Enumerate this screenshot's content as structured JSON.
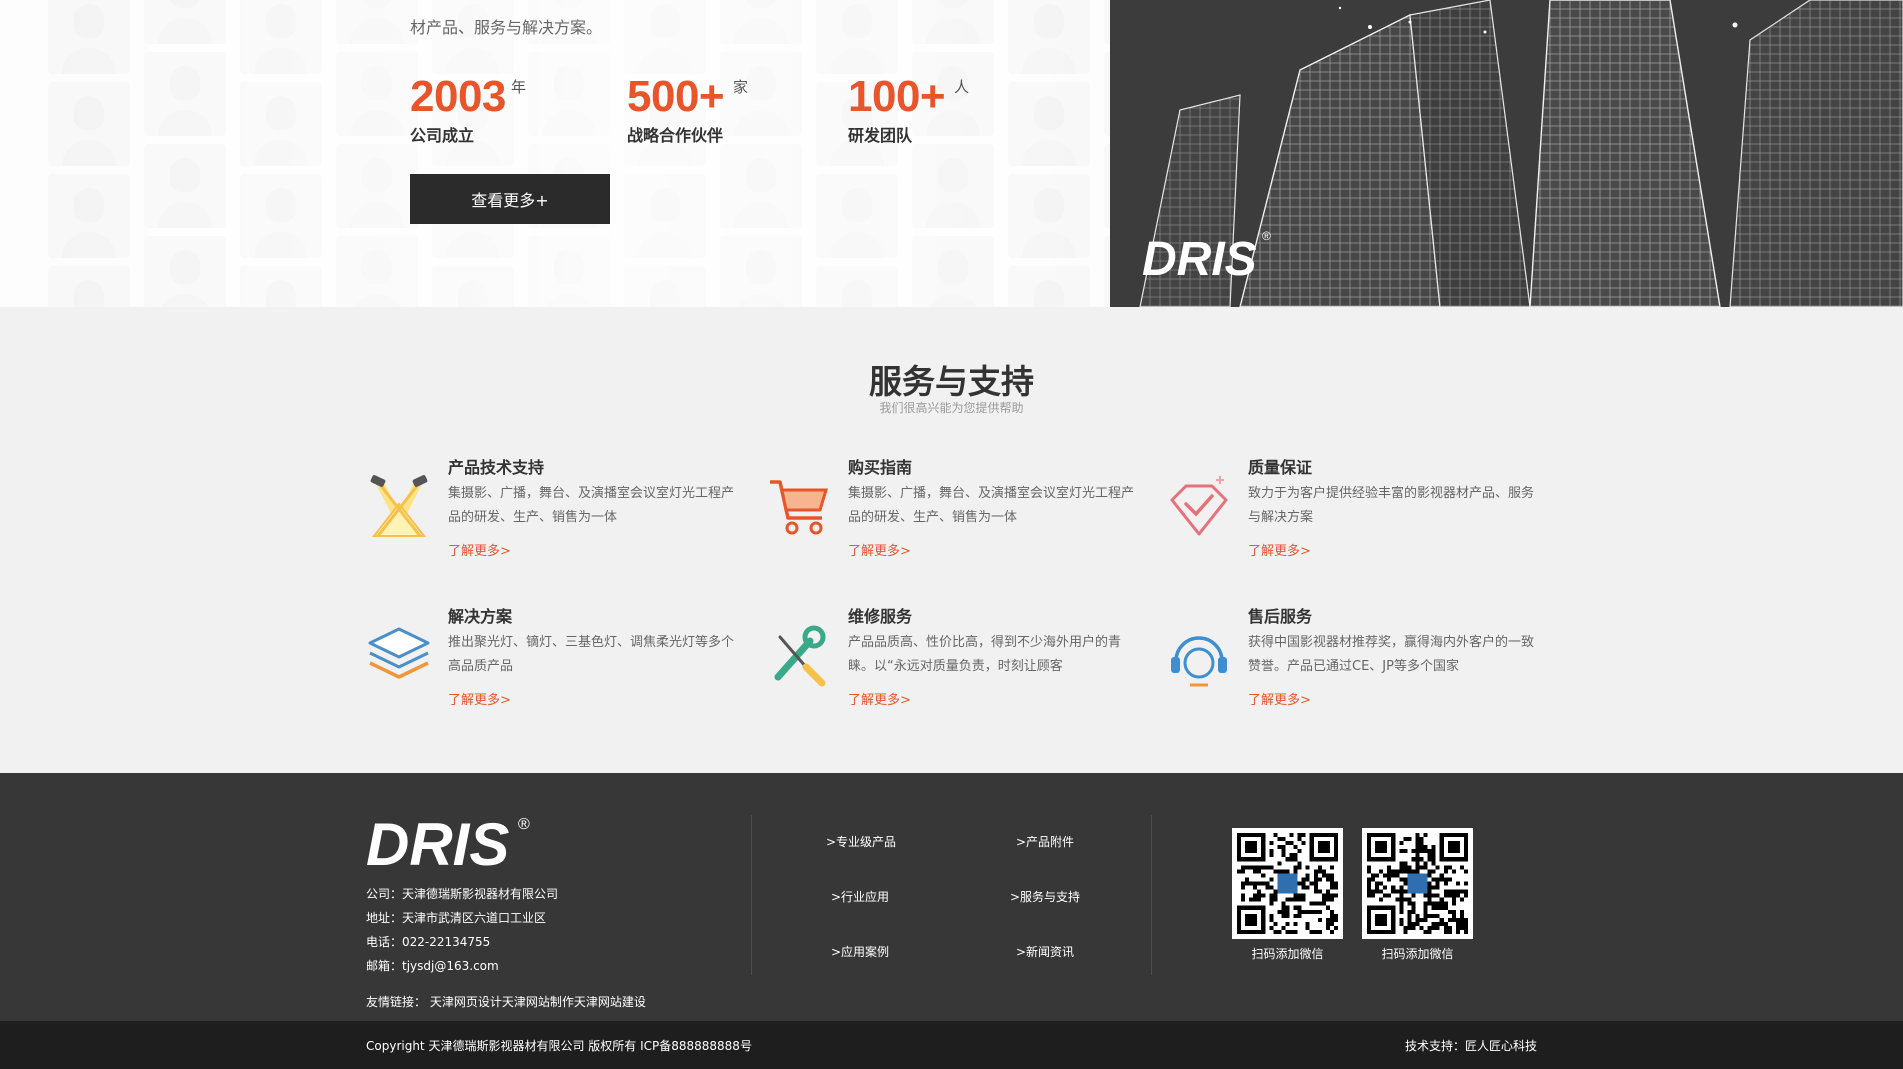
{
  "about": {
    "description_partial": "材产品、服务与解决方案。",
    "stats": [
      {
        "value": "2003",
        "unit": "年",
        "label": "公司成立"
      },
      {
        "value": "500+",
        "unit": "家",
        "label": "战略合作伙伴"
      },
      {
        "value": "100+",
        "unit": "人",
        "label": "研发团队"
      }
    ],
    "more_button": "查看更多+",
    "image_logo_text": "DRIS"
  },
  "services": {
    "title": "服务与支持",
    "subtitle": "我们很高兴能为您提供帮助",
    "items": [
      {
        "title": "产品技术支持",
        "desc": "集摄影、广播，舞台、及演播室会议室灯光工程产品的研发、生产、销售为一体",
        "more": "了解更多>",
        "icon": "spotlight-icon"
      },
      {
        "title": "购买指南",
        "desc": "集摄影、广播，舞台、及演播室会议室灯光工程产品的研发、生产、销售为一体",
        "more": "了解更多>",
        "icon": "shopping-cart-icon"
      },
      {
        "title": "质量保证",
        "desc": "致力于为客户提供经验丰富的影视器材产品、服务与解决方案",
        "more": "了解更多>",
        "icon": "diamond-check-icon"
      },
      {
        "title": "解决方案",
        "desc": "推出聚光灯、镝灯、三基色灯、调焦柔光灯等多个高品质产品",
        "more": "了解更多>",
        "icon": "layers-icon"
      },
      {
        "title": "维修服务",
        "desc": "产品品质高、性价比高，得到不少海外用户的青睐。以“永远对质量负责，时刻让顾客",
        "more": "了解更多>",
        "icon": "wrench-screwdriver-icon"
      },
      {
        "title": "售后服务",
        "desc": "获得中国影视器材推荐奖，赢得海内外客户的一致赞誉。产品已通过CE、JP等多个国家",
        "more": "了解更多>",
        "icon": "headset-icon"
      }
    ]
  },
  "footer": {
    "logo_text": "DRIS",
    "logo_mark": "®",
    "company": "公司：天津德瑞斯影视器材有限公司",
    "address": "地址：天津市武清区六道口工业区",
    "phone": "电话：022-22134755",
    "email": "邮箱：tjysdj@163.com",
    "friend_links": "友情链接： 天津网页设计天津网站制作天津网站建设",
    "links": [
      ">专业级产品",
      ">产品附件",
      ">行业应用",
      ">服务与支持",
      ">应用案例",
      ">新闻资讯"
    ],
    "qr_captions": [
      "扫码添加微信",
      "扫码添加微信"
    ],
    "copyright": "Copyright 天津德瑞斯影视器材有限公司 版权所有 ICP备888888888号",
    "tech_support": "技术支持：匠人匠心科技"
  },
  "colors": {
    "accent": "#e8552b",
    "dark_button": "#2b2b2b",
    "footer_bg": "#373737",
    "bottom_bar_bg": "#1e1e1e",
    "services_bg": "#f1f1f1"
  }
}
